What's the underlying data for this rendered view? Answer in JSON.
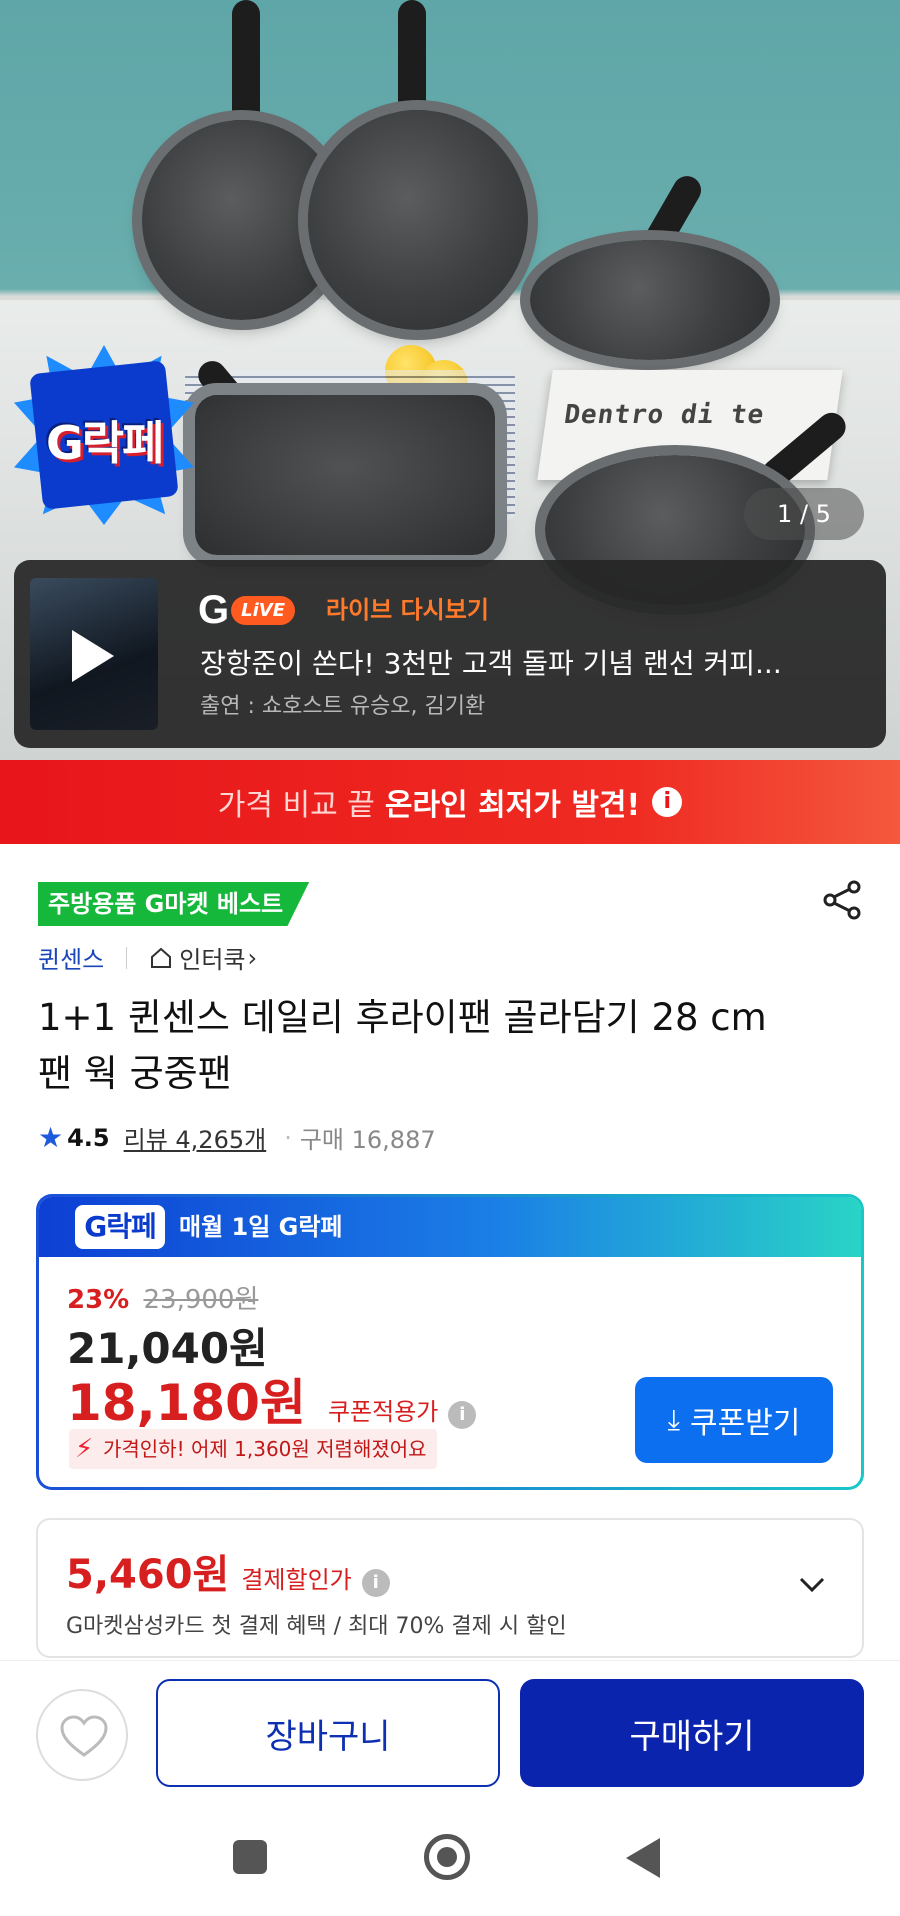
{
  "hero": {
    "book_text": "Dentro di te",
    "badge_text": "G락페",
    "counter": "1 / 5"
  },
  "live": {
    "logo_g": "G",
    "logo_live": "LiVE",
    "label": "라이브 다시보기",
    "title": "장항준이 쏜다! 3천만 고객 돌파 기념 랜선 커피...",
    "cast": "출연 : 쇼호스트 유승오, 김기환"
  },
  "banner": {
    "light": "가격 비교 끝",
    "strong": "온라인 최저가 발견!",
    "info": "i"
  },
  "product": {
    "best_tag": "주방용품 G마켓 베스트",
    "brand": "퀸센스",
    "store": "인터쿡",
    "store_chevron": "›",
    "title": "1+1 퀸센스 데일리 후라이팬 골라담기 28 cm 팬 웍 궁중팬",
    "rating": "4.5",
    "review_label": "리뷰 4,265개",
    "sep_dot": "·",
    "purchases": "구매 16,887"
  },
  "price": {
    "head_logo": "G락페",
    "head_text": "매월 1일 G락페",
    "discount_pct": "23%",
    "original_price": "23,900원",
    "sale_price": "21,040원",
    "coupon_price": "18,180원",
    "coupon_label": "쿠폰적용가",
    "info": "i",
    "drop_note": "가격인하! 어제 1,360원 저렴해졌어요",
    "coupon_button": "쿠폰받기",
    "accent_red": "#d81f1f",
    "accent_blue": "#0b6ff0"
  },
  "payment": {
    "amount": "5,460원",
    "label": "결제할인가",
    "info": "i",
    "description": "G마켓삼성카드 첫 결제 혜택 / 최대 70% 결제 시 할인"
  },
  "bottom": {
    "cart": "장바구니",
    "buy": "구매하기",
    "brand_navy": "#0b24ad"
  }
}
